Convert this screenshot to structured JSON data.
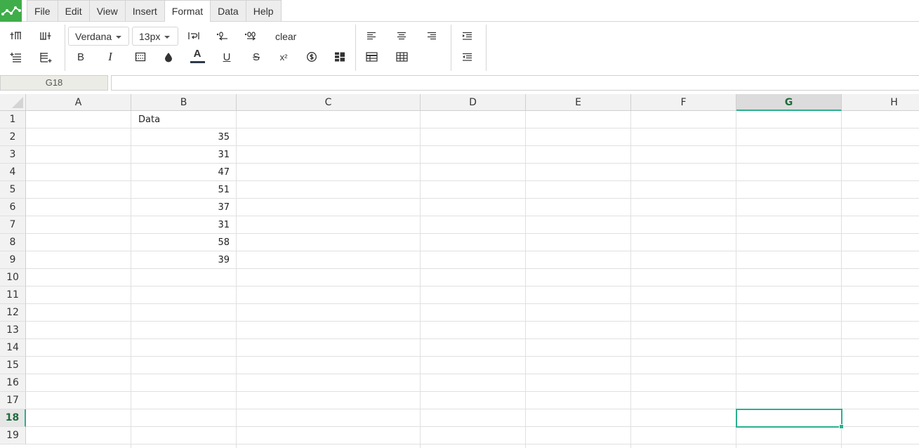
{
  "menu": {
    "items": [
      {
        "id": "file",
        "label": "File"
      },
      {
        "id": "edit",
        "label": "Edit"
      },
      {
        "id": "view",
        "label": "View"
      },
      {
        "id": "insert",
        "label": "Insert"
      },
      {
        "id": "format",
        "label": "Format"
      },
      {
        "id": "data",
        "label": "Data"
      },
      {
        "id": "help",
        "label": "Help"
      }
    ],
    "active": "Format"
  },
  "toolbar": {
    "font_family": "Verdana",
    "font_size": "13px",
    "clear_label": "clear",
    "bold_label": "B",
    "italic_label": "I",
    "text_color_label": "A",
    "underline_label": "U",
    "strike_label": "S",
    "superscript_label": "x²",
    "text_color": "#2d3a4a"
  },
  "formula_bar": {
    "cell_ref": "G18",
    "value": ""
  },
  "grid": {
    "columns": [
      "A",
      "B",
      "C",
      "D",
      "E",
      "F",
      "G",
      "H"
    ],
    "selected_column": "G",
    "rows": [
      "1",
      "2",
      "3",
      "4",
      "5",
      "6",
      "7",
      "8",
      "9",
      "10",
      "11",
      "12",
      "13",
      "14",
      "15",
      "16",
      "17",
      "18",
      "19"
    ],
    "selected_row": "18",
    "cells": {
      "B1": "Data",
      "B2": "35",
      "B3": "31",
      "B4": "47",
      "B5": "51",
      "B6": "37",
      "B7": "31",
      "B8": "58",
      "B9": "39"
    }
  },
  "colors": {
    "logo": "#3fad4a",
    "selection": "#2ab08f",
    "header_bg": "#f2f2f2"
  }
}
